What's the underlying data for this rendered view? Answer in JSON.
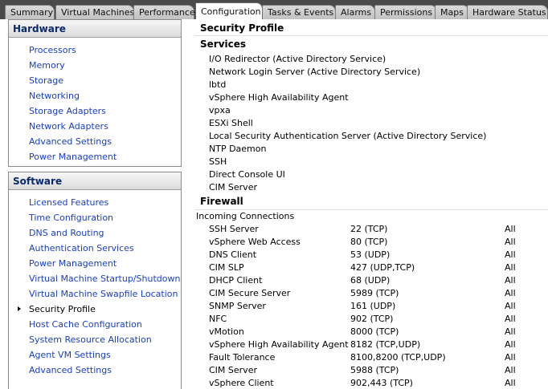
{
  "tabs": [
    "Summary",
    "Virtual Machines",
    "Performance",
    "Configuration",
    "Tasks & Events",
    "Alarms",
    "Permissions",
    "Maps",
    "Hardware Status"
  ],
  "active_tab": "Configuration",
  "hardware": {
    "title": "Hardware",
    "items": [
      "Processors",
      "Memory",
      "Storage",
      "Networking",
      "Storage Adapters",
      "Network Adapters",
      "Advanced Settings",
      "Power Management"
    ]
  },
  "software": {
    "title": "Software",
    "items": [
      "Licensed Features",
      "Time Configuration",
      "DNS and Routing",
      "Authentication Services",
      "Power Management",
      "Virtual Machine Startup/Shutdown",
      "Virtual Machine Swapfile Location",
      "Security Profile",
      "Host Cache Configuration",
      "System Resource Allocation",
      "Agent VM Settings",
      "Advanced Settings"
    ],
    "selected": "Security Profile"
  },
  "content": {
    "title": "Security Profile",
    "services_title": "Services",
    "services": [
      "I/O Redirector (Active Directory Service)",
      "Network Login Server (Active Directory Service)",
      "lbtd",
      "vSphere High Availability Agent",
      "vpxa",
      "ESXi Shell",
      "Local Security Authentication Server (Active Directory Service)",
      "NTP Daemon",
      "SSH",
      "Direct Console UI",
      "CIM Server"
    ],
    "firewall_title": "Firewall",
    "incoming_label": "Incoming Connections",
    "firewall_rows": [
      {
        "name": "SSH Server",
        "ports": "22 (TCP)",
        "allowed": "All"
      },
      {
        "name": "vSphere Web Access",
        "ports": "80 (TCP)",
        "allowed": "All"
      },
      {
        "name": "DNS Client",
        "ports": "53 (UDP)",
        "allowed": "All"
      },
      {
        "name": "CIM SLP",
        "ports": "427 (UDP,TCP)",
        "allowed": "All"
      },
      {
        "name": "DHCP Client",
        "ports": "68 (UDP)",
        "allowed": "All"
      },
      {
        "name": "CIM Secure Server",
        "ports": "5989 (TCP)",
        "allowed": "All"
      },
      {
        "name": "SNMP Server",
        "ports": "161 (UDP)",
        "allowed": "All"
      },
      {
        "name": "NFC",
        "ports": "902 (TCP)",
        "allowed": "All"
      },
      {
        "name": "vMotion",
        "ports": "8000 (TCP)",
        "allowed": "All"
      },
      {
        "name": "vSphere High Availability Agent",
        "ports": "8182 (TCP,UDP)",
        "allowed": "All"
      },
      {
        "name": "Fault Tolerance",
        "ports": "8100,8200 (TCP,UDP)",
        "allowed": "All"
      },
      {
        "name": "CIM Server",
        "ports": "5988 (TCP)",
        "allowed": "All"
      },
      {
        "name": "vSphere Client",
        "ports": "902,443 (TCP)",
        "allowed": "All"
      }
    ]
  },
  "colors": {
    "link": "#1a3fbf",
    "panel_title": "#0b2a6e",
    "tabbar": "#4a4a4a"
  }
}
